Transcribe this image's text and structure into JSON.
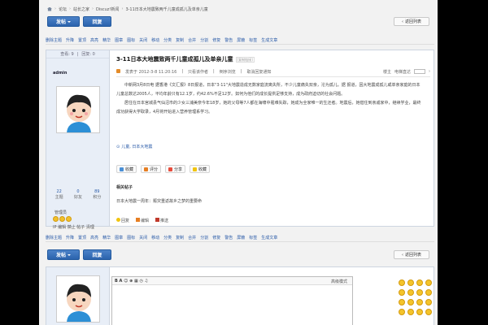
{
  "breadcrumb": {
    "items": [
      "论坛",
      "站长之家",
      "Discuz!新闻",
      "3-11日本大地震致两千儿童成孤儿及单亲儿童"
    ]
  },
  "buttons": {
    "post": "发帖",
    "reply": "回复",
    "back": "返回列表"
  },
  "toolbar": {
    "items": [
      "删除主题",
      "升降",
      "置顶",
      "高亮",
      "精华",
      "图章",
      "图标",
      "关闭",
      "移动",
      "分类",
      "复制",
      "合并",
      "分割",
      "修复",
      "警告",
      "屏蔽",
      "标签",
      "生成文章"
    ]
  },
  "post": {
    "view_count": "查看: 9",
    "reply_count": "回复: 0",
    "author": "admin",
    "stats": [
      {
        "value": "22",
        "label": "主题"
      },
      {
        "value": "0",
        "label": "好友"
      },
      {
        "value": "89",
        "label": "积分"
      }
    ],
    "role": "管理员",
    "user_links": "IP 编辑 禁止 帖子 清理",
    "title": "3-11日本大地震致两千儿童成孤儿及单亲儿童",
    "copy_link": "[复制链接]",
    "meta": {
      "posted": "发表于 2012-3-8 11:20:16",
      "author_only": "只看该作者",
      "reverse": "倒序浏览",
      "cancel_notify": "取消回复通知"
    },
    "meta_right": {
      "floor": "楼主",
      "electric": "电梯直达"
    },
    "body": [
      "中新网3月8日电 据香港《文汇报》8日报道，日本\"3·11\"大地震造成无数家庭流离失所，不少儿童痛失双亲，沦为孤儿。据 报道，因大地震成孤儿或单亲家庭的日本儿童总数达2005人，平均年龄只有12.1岁，约42.6%不足12岁。如何为他们的成长提供足够支持，成为政府迫切的社会问题。",
      "居住在日本宫城县气仙沼市的少女三浦美奈今年18岁，她的父母等7人都在海啸中罹难失踪，她成为全家唯一的生还者。地震后，她借住到亲戚家中，继续学业，最终成功获得大学取录，4月将开始进入营养管理系学习。"
    ],
    "tags": "儿童, 日本大地震",
    "actions": [
      "收藏",
      "评分",
      "分享",
      "收藏"
    ],
    "related_heading": "相关帖子",
    "related_item": "日本大地震一周年：赈灾重返故乡之梦的重要命",
    "footer": [
      "回复",
      "编辑",
      "推送"
    ]
  },
  "editor": {
    "mode_label": "高级模式",
    "toolbar": "B  A  ☺  ⊕  ▦  ◷  ♫"
  }
}
